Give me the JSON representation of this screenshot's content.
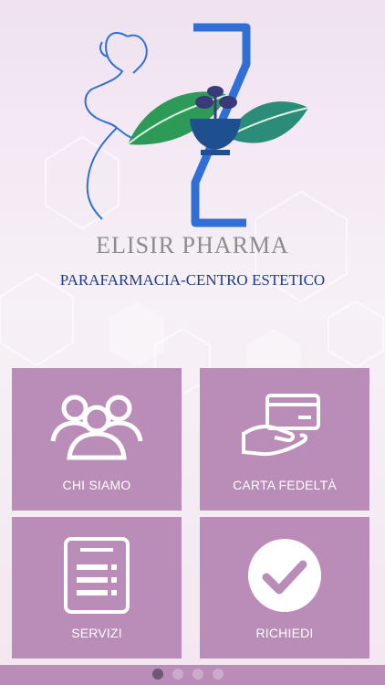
{
  "brand": {
    "name": "ELISIR PHARMA",
    "tagline": "PARAFARMACIA-CENTRO ESTETICO"
  },
  "menu": [
    {
      "label": "CHI SIAMO",
      "icon": "people-group-icon"
    },
    {
      "label": "CARTA FEDELTÀ",
      "icon": "hand-card-icon"
    },
    {
      "label": "SERVIZI",
      "icon": "document-list-icon"
    },
    {
      "label": "RICHIEDI",
      "icon": "checkmark-circle-icon"
    }
  ],
  "pager": {
    "count": 4,
    "active": 1
  },
  "colors": {
    "tile": "#ba8cb8",
    "brand_text": "#8c8c8c",
    "tagline_text": "#1f3c88",
    "logo_blue": "#2f6fd6",
    "logo_green": "#2e9a58",
    "logo_teal": "#1e4f8f"
  }
}
